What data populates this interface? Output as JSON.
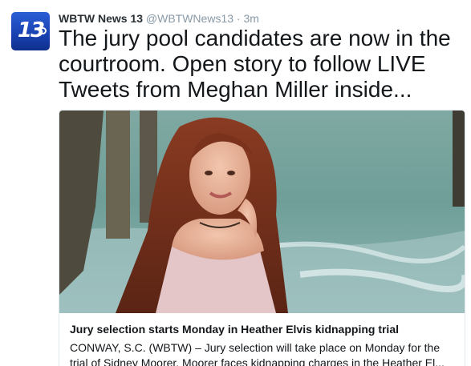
{
  "tweet": {
    "avatar_text": "13",
    "author_name": "WBTW News 13",
    "author_handle": "@WBTWNews13",
    "separator": "·",
    "timestamp": "3m",
    "text": "The jury pool candidates are now in the courtroom.  Open story to follow LIVE Tweets from Meghan Miller inside...",
    "avatar_color": "#1840b0"
  },
  "card": {
    "title": "Jury selection starts Monday in Heather Elvis kidnapping trial",
    "description_line1": "CONWAY, S.C. (WBTW) – Jury selection will take place on Monday for the",
    "description_line2": "trial of Sidney Moorer. Moorer faces kidnapping charges in the Heather El...",
    "image_icon": "woman-at-beach-photo"
  }
}
